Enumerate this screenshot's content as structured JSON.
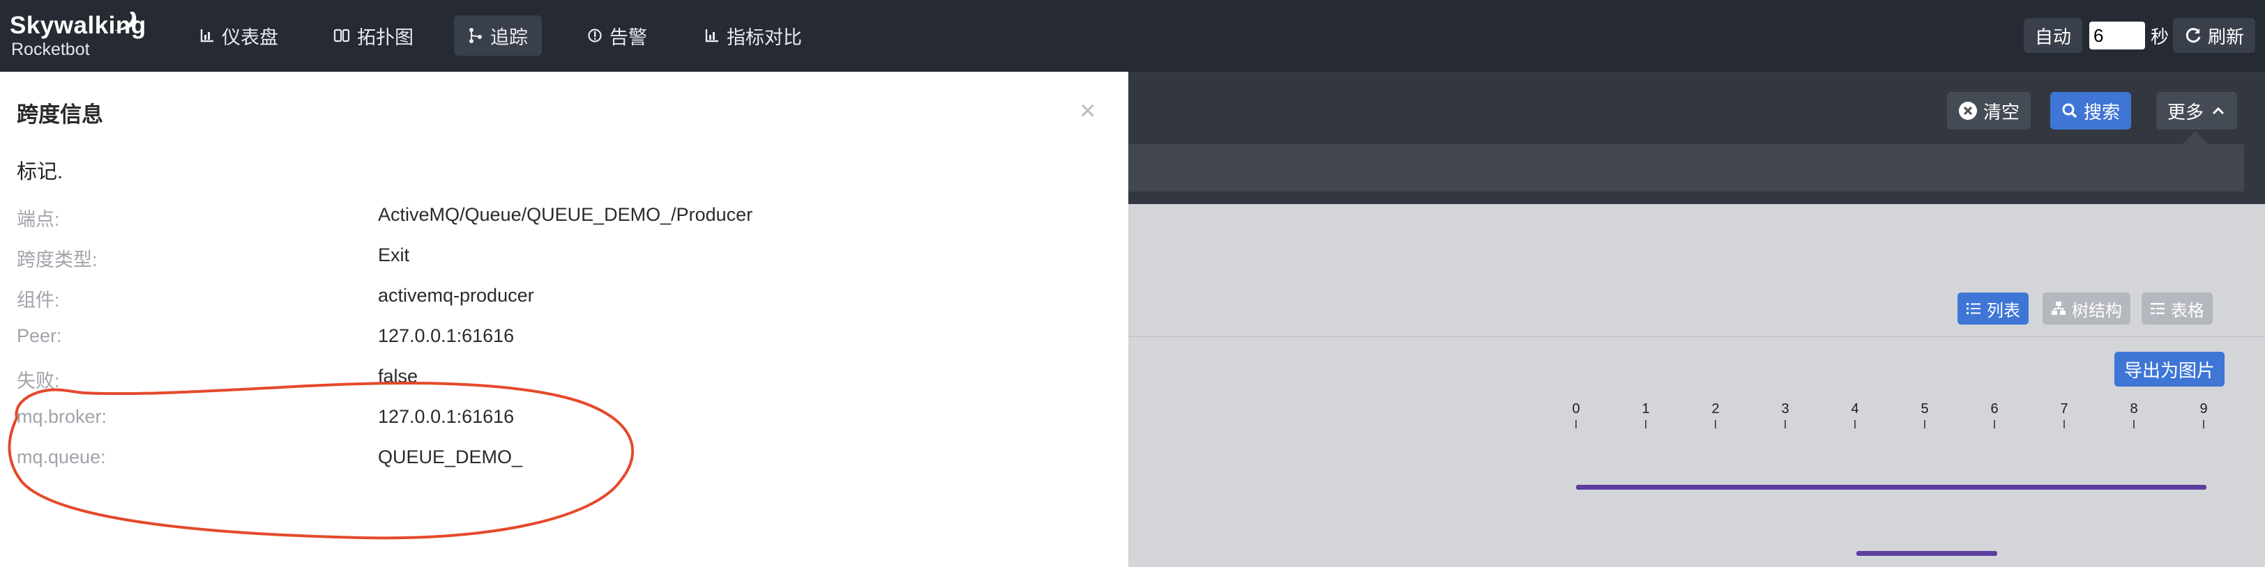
{
  "colors": {
    "navbar_bg": "#252a33",
    "primary": "#3f76d6",
    "annotation": "#e5492b",
    "trace_bar": "#5d3d9e"
  },
  "app": {
    "brand": "Skywalking",
    "sub": "Rocketbot"
  },
  "nav": [
    {
      "label": "仪表盘",
      "icon": "chart-icon",
      "active": false
    },
    {
      "label": "拓扑图",
      "icon": "topology-icon",
      "active": false
    },
    {
      "label": "追踪",
      "icon": "trace-icon",
      "active": true
    },
    {
      "label": "告警",
      "icon": "alert-icon",
      "active": false
    },
    {
      "label": "指标对比",
      "icon": "chart-icon",
      "active": false
    }
  ],
  "auto_refresh": {
    "auto_label": "自动",
    "interval": "6",
    "unit": "秒",
    "refresh_label": "刷新"
  },
  "toolbar": {
    "clear_label": "清空",
    "search_label": "搜索",
    "more_label": "更多"
  },
  "view": {
    "list_label": "列表",
    "tree_label": "树结构",
    "table_label": "表格",
    "export_label": "导出为图片"
  },
  "timeline": {
    "ticks": [
      "0",
      "1",
      "2",
      "3",
      "4",
      "5",
      "6",
      "7",
      "8",
      "9"
    ]
  },
  "span_panel": {
    "title": "跨度信息",
    "section": "标记.",
    "rows": [
      {
        "key": "端点:",
        "value": "ActiveMQ/Queue/QUEUE_DEMO_/Producer"
      },
      {
        "key": "跨度类型:",
        "value": "Exit"
      },
      {
        "key": "组件:",
        "value": "activemq-producer"
      },
      {
        "key": "Peer:",
        "value": "127.0.0.1:61616"
      },
      {
        "key": "失败:",
        "value": "false"
      },
      {
        "key": "mq.broker:",
        "value": "127.0.0.1:61616"
      },
      {
        "key": "mq.queue:",
        "value": "QUEUE_DEMO_"
      }
    ]
  }
}
